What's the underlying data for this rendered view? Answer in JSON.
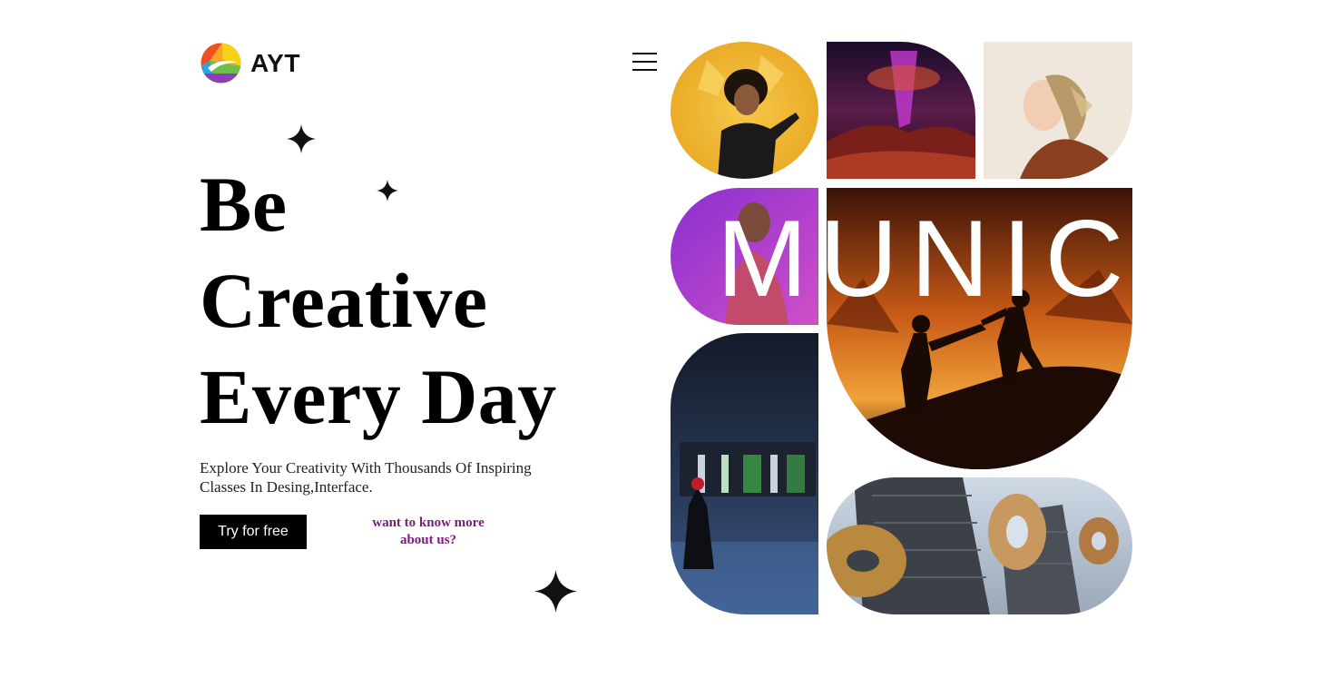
{
  "brand": {
    "name": "AYT",
    "logo_icon": "ayt-logo-icon"
  },
  "nav": {
    "menu_icon": "hamburger-menu-icon"
  },
  "hero": {
    "headline_lines": [
      "Be",
      "Creative",
      "Every Day"
    ],
    "subtitle": "Explore Your Creativity With Thousands Of Inspiring Classes In Desing,Interface.",
    "cta_label": "Try for free",
    "more_link": "want to know more about us?"
  },
  "gallery": {
    "tile_m_letter": "M",
    "tile_banner_text": "UNIC"
  },
  "colors": {
    "accent_link": "#7b1b7e",
    "button_bg": "#000000",
    "tile_yellow": "#f2b52a",
    "tile_purple": "#a03fc7",
    "tile_orange": "#d9781e",
    "tile_night": "#22324e"
  }
}
